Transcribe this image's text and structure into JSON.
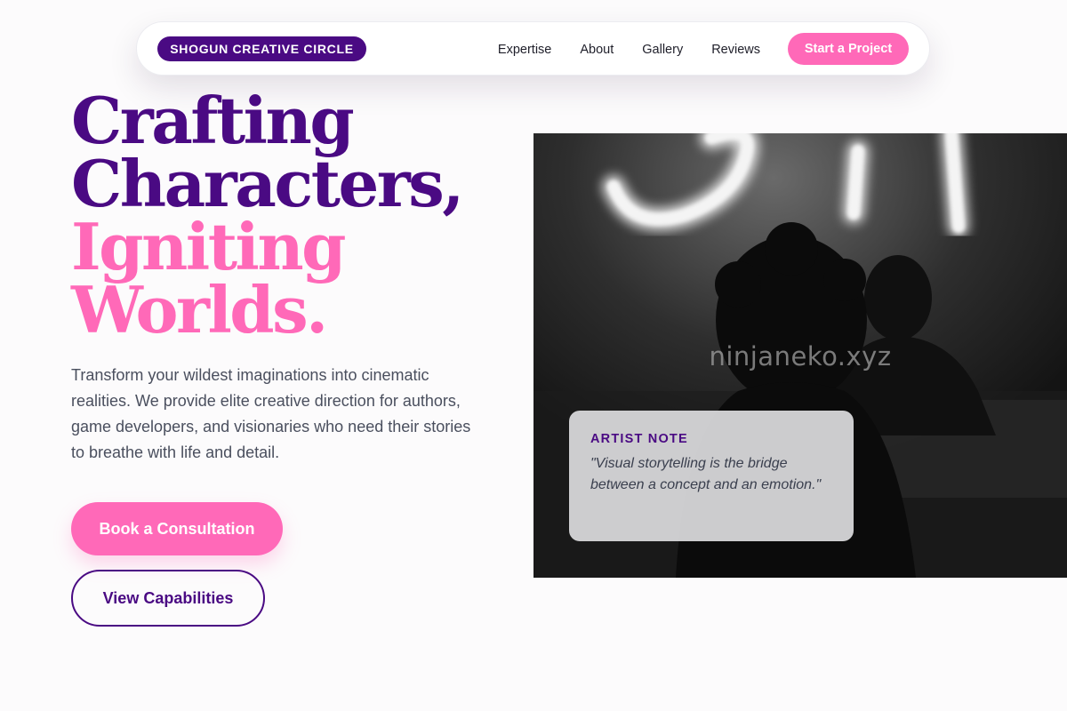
{
  "nav": {
    "brand": "SHOGUN CREATIVE CIRCLE",
    "links": [
      "Expertise",
      "About",
      "Gallery",
      "Reviews"
    ],
    "cta": "Start a Project"
  },
  "hero": {
    "headline": {
      "line1": "Crafting",
      "line2": "Characters,",
      "line3": "Igniting",
      "line4": "Worlds."
    },
    "lede": "Transform your wildest imaginations into cinematic realities. We provide elite creative direction for authors, game developers, and visionaries who need their stories to breathe with life and detail.",
    "primary_button": "Book a Consultation",
    "secondary_button": "View Capabilities"
  },
  "image": {
    "watermark": "ninjaneko.xyz",
    "note": {
      "title": "ARTIST NOTE",
      "quote": "\"Visual storytelling is the bridge between a concept and an emotion.\""
    }
  },
  "colors": {
    "accent_purple": "#4a0a83",
    "accent_pink": "#ff69b8",
    "background": "#fcfbfc"
  }
}
